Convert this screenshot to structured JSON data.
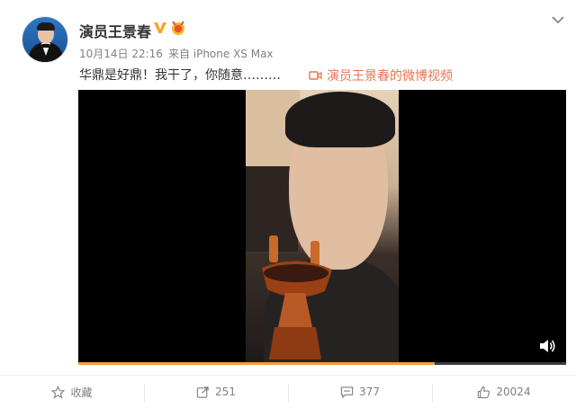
{
  "post": {
    "author": "演员王景春",
    "verified_icon": "verified-v-icon",
    "badge_icon": "medal-badge-icon",
    "date": "10月14日 22:16",
    "source": "来自 iPhone XS Max",
    "text": "华鼎是好鼎！我干了，你随意………",
    "video_link": "演员王景春的微博视频",
    "colors": {
      "link": "#eb7350",
      "verified": "#f5a623",
      "progress": "#f29c38"
    }
  },
  "video": {
    "progress_fraction": 0.73,
    "volume_icon": "speaker-icon"
  },
  "actions": [
    {
      "icon": "star-icon",
      "label": "收藏"
    },
    {
      "icon": "repost-icon",
      "label": "251"
    },
    {
      "icon": "comment-icon",
      "label": "377"
    },
    {
      "icon": "like-icon",
      "label": "20024"
    }
  ]
}
